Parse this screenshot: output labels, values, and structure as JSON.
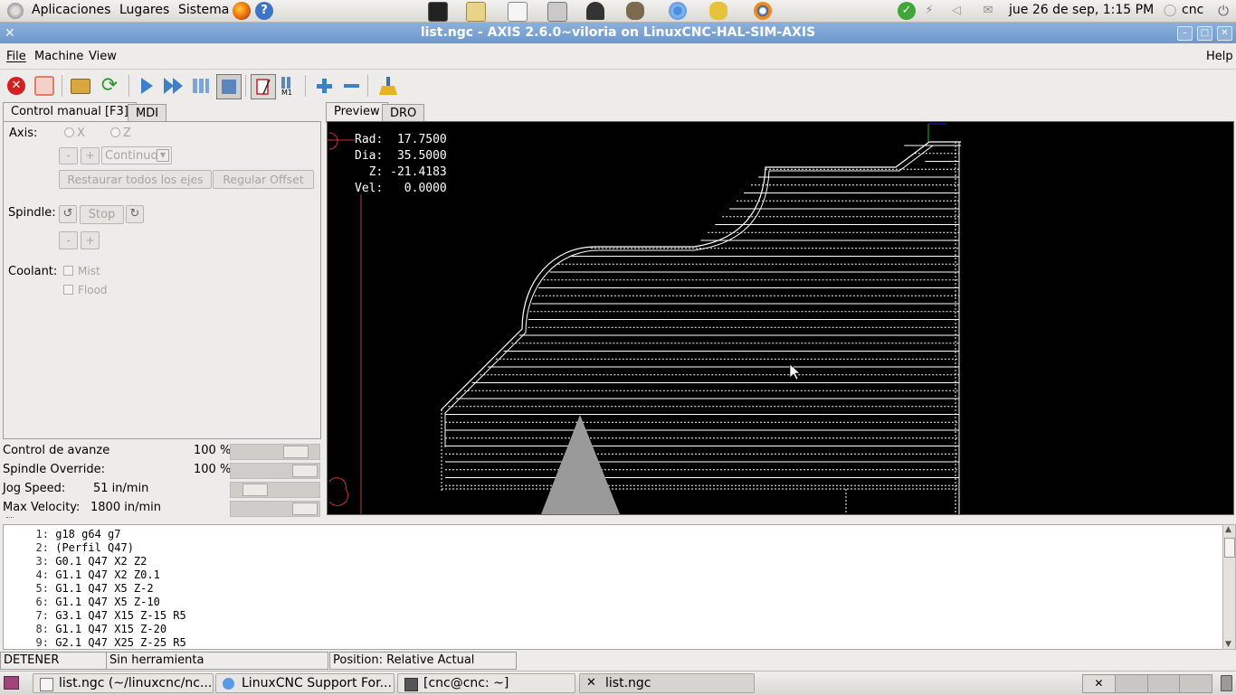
{
  "top_panel": {
    "menus": [
      "Aplicaciones",
      "Lugares",
      "Sistema"
    ],
    "clock": "jue 26 de sep,  1:15 PM",
    "user": "cnc"
  },
  "window": {
    "title": "list.ngc - AXIS 2.6.0~viloria on LinuxCNC-HAL-SIM-AXIS"
  },
  "menubar": {
    "file": "File",
    "machine": "Machine",
    "view": "View",
    "help": "Help"
  },
  "toolbar": {
    "icons": [
      "estop-icon",
      "machine-power-icon",
      "open-file-icon",
      "reload-icon",
      "run-icon",
      "step-icon",
      "pause-icon",
      "stop-icon",
      "block-delete-icon",
      "optional-stop-icon",
      "zoom-in-icon",
      "zoom-out-icon",
      "clear-backplot-icon"
    ]
  },
  "left_panel": {
    "tabs": [
      "Control manual [F3]",
      "MDI"
    ],
    "axis_label": "Axis:",
    "axis_options": [
      "X",
      "Z"
    ],
    "jog_minus": "-",
    "jog_plus": "+",
    "jog_mode": "Continuo",
    "home_all": "Restaurar todos los ejes",
    "touch_off": "Regular Offset",
    "spindle_label": "Spindle:",
    "spindle_stop": "Stop",
    "spindle_minus": "-",
    "spindle_plus": "+",
    "coolant_label": "Coolant:",
    "mist": "Mist",
    "flood": "Flood"
  },
  "overrides": {
    "feed_label": "Control de avanze",
    "feed_value": "100 %",
    "feed_level": 100,
    "spindle_label": "Spindle Override:",
    "spindle_value": "100 %",
    "spindle_level": 100,
    "jog_label": "Jog Speed:",
    "jog_value": "51 in/min",
    "maxvel_label": "Max Velocity:",
    "maxvel_value": "1800 in/min"
  },
  "preview": {
    "tabs": [
      "Preview",
      "DRO"
    ],
    "dro": {
      "rad_label": "Rad:",
      "rad": "17.7500",
      "dia_label": "Dia:",
      "dia": "35.5000",
      "z_label": "Z:",
      "z": "-21.4183",
      "vel_label": "Vel:",
      "vel": "0.0000"
    }
  },
  "gcode": [
    {
      "n": "1:",
      "text": "g18 g64 g7"
    },
    {
      "n": "2:",
      "text": "(Perfil Q47)"
    },
    {
      "n": "3:",
      "text": "G0.1 Q47 X2 Z2"
    },
    {
      "n": "4:",
      "text": "G1.1 Q47 X2 Z0.1"
    },
    {
      "n": "5:",
      "text": "G1.1 Q47 X5 Z-2"
    },
    {
      "n": "6:",
      "text": "G1.1 Q47 X5 Z-10"
    },
    {
      "n": "7:",
      "text": "G3.1 Q47 X15 Z-15 R5"
    },
    {
      "n": "8:",
      "text": "G1.1 Q47 X15 Z-20"
    },
    {
      "n": "9:",
      "text": "G2.1 Q47 X25 Z-25 R5"
    }
  ],
  "statusbar": {
    "state": "DETENER",
    "tool": "Sin herramienta",
    "position": "Position: Relative Actual"
  },
  "taskbar": {
    "tasks": [
      "list.ngc (~/linuxcnc/nc...",
      "LinuxCNC Support For...",
      "[cnc@cnc: ~]",
      "list.ngc"
    ]
  }
}
